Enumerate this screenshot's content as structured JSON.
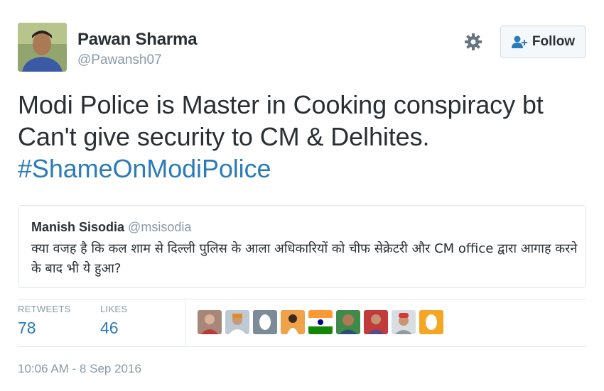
{
  "author": {
    "name": "Pawan Sharma",
    "handle": "@Pawansh07"
  },
  "actions": {
    "follow_label": "Follow",
    "settings_icon": "gear-icon",
    "follow_icon": "add-user-icon"
  },
  "tweet": {
    "line1": "Modi Police is Master in Cooking conspiracy bt",
    "line2": "Can't give security to CM & Delhites.",
    "hashtag": "#ShameOnModiPolice"
  },
  "quoted": {
    "name": "Manish Sisodia",
    "handle": "@msisodia",
    "text": "क्या वजह है कि कल शाम से दिल्ली पुलिस के आला अधिकारियों को चीफ सेक्रेटरी और CM office द्वारा आगाह करने के बाद भी ये हुआ?"
  },
  "stats": {
    "retweets_label": "RETWEETS",
    "retweets_value": "78",
    "likes_label": "LIKES",
    "likes_value": "46"
  },
  "timestamp": "10:06 AM - 8 Sep 2016",
  "colors": {
    "link": "#2b7bb9",
    "secondary": "#8899a6",
    "text": "#292f33",
    "border": "#e1e8ed"
  }
}
